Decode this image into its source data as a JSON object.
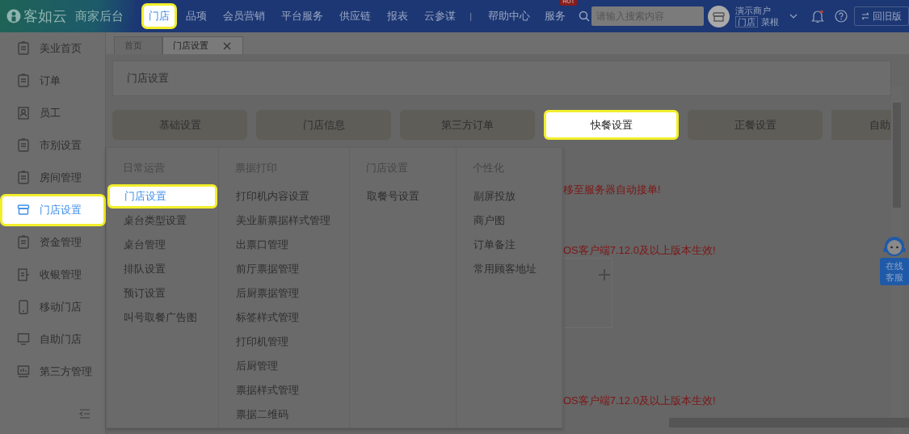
{
  "topbar": {
    "logo": "客如云",
    "subtitle": "商家后台",
    "nav": [
      {
        "label": "门店",
        "highlighted": true
      },
      {
        "label": "品项",
        "highlighted": false
      },
      {
        "label": "会员营销",
        "highlighted": false
      },
      {
        "label": "平台服务",
        "highlighted": false
      },
      {
        "label": "供应链",
        "highlighted": false
      },
      {
        "label": "报表",
        "highlighted": false
      },
      {
        "label": "云参谋",
        "highlighted": false
      }
    ],
    "separator": "|",
    "links": [
      {
        "label": "帮助中心"
      },
      {
        "label": "服务",
        "badge": "HOT"
      }
    ],
    "search": {
      "placeholder": "请输入搜索内容"
    },
    "account": {
      "name": "演示商户",
      "tag": "门店",
      "store": "菜根"
    },
    "old_version": "回旧版"
  },
  "sidebar": {
    "items": [
      {
        "label": "美业首页",
        "highlighted": false
      },
      {
        "label": "订单",
        "highlighted": false
      },
      {
        "label": "员工",
        "highlighted": false
      },
      {
        "label": "市别设置",
        "highlighted": false
      },
      {
        "label": "房间管理",
        "highlighted": false
      },
      {
        "label": "门店设置",
        "highlighted": true
      },
      {
        "label": "资金管理",
        "highlighted": false
      },
      {
        "label": "收银管理",
        "highlighted": false
      },
      {
        "label": "移动门店",
        "highlighted": false
      },
      {
        "label": "自助门店",
        "highlighted": false
      },
      {
        "label": "第三方管理",
        "highlighted": false
      }
    ]
  },
  "tabs": [
    {
      "label": "首页",
      "selected": false,
      "closable": false
    },
    {
      "label": "门店设置",
      "selected": true,
      "closable": true
    }
  ],
  "page_title": "门店设置",
  "section_tabs": [
    {
      "label": "基础设置",
      "highlighted": false
    },
    {
      "label": "门店信息",
      "highlighted": false
    },
    {
      "label": "第三方订单",
      "highlighted": false
    },
    {
      "label": "快餐设置",
      "highlighted": true
    },
    {
      "label": "正餐设置",
      "highlighted": false
    },
    {
      "label": "自助",
      "highlighted": false
    }
  ],
  "notices": [
    "移至服务器自动接单!",
    "OS客户端7.12.0及以上版本生效!",
    "OS客户端7.12.0及以上版本生效!"
  ],
  "menu": {
    "columns": [
      {
        "heading": "日常运营",
        "items": [
          {
            "label": "门店设置",
            "highlighted": true
          },
          {
            "label": "桌台类型设置",
            "highlighted": false
          },
          {
            "label": "桌台管理",
            "highlighted": false
          },
          {
            "label": "排队设置",
            "highlighted": false
          },
          {
            "label": "预订设置",
            "highlighted": false
          },
          {
            "label": "叫号取餐广告图",
            "highlighted": false
          }
        ]
      },
      {
        "heading": "票据打印",
        "items": [
          {
            "label": "打印机内容设置",
            "highlighted": false
          },
          {
            "label": "美业新票据样式管理",
            "highlighted": false
          },
          {
            "label": "出票口管理",
            "highlighted": false
          },
          {
            "label": "前厅票据管理",
            "highlighted": false
          },
          {
            "label": "后厨票据管理",
            "highlighted": false
          },
          {
            "label": "标签样式管理",
            "highlighted": false
          },
          {
            "label": "打印机管理",
            "highlighted": false
          },
          {
            "label": "后厨管理",
            "highlighted": false
          },
          {
            "label": "票据样式管理",
            "highlighted": false
          },
          {
            "label": "票据二维码",
            "highlighted": false
          }
        ]
      },
      {
        "heading": "门店设置",
        "items": [
          {
            "label": "取餐号设置",
            "highlighted": false
          }
        ]
      },
      {
        "heading": "个性化",
        "items": [
          {
            "label": "副屏投放",
            "highlighted": false
          },
          {
            "label": "商户图",
            "highlighted": false
          },
          {
            "label": "订单备注",
            "highlighted": false
          },
          {
            "label": "常用顾客地址",
            "highlighted": false
          }
        ]
      }
    ]
  },
  "support": {
    "label": "在线客服"
  }
}
